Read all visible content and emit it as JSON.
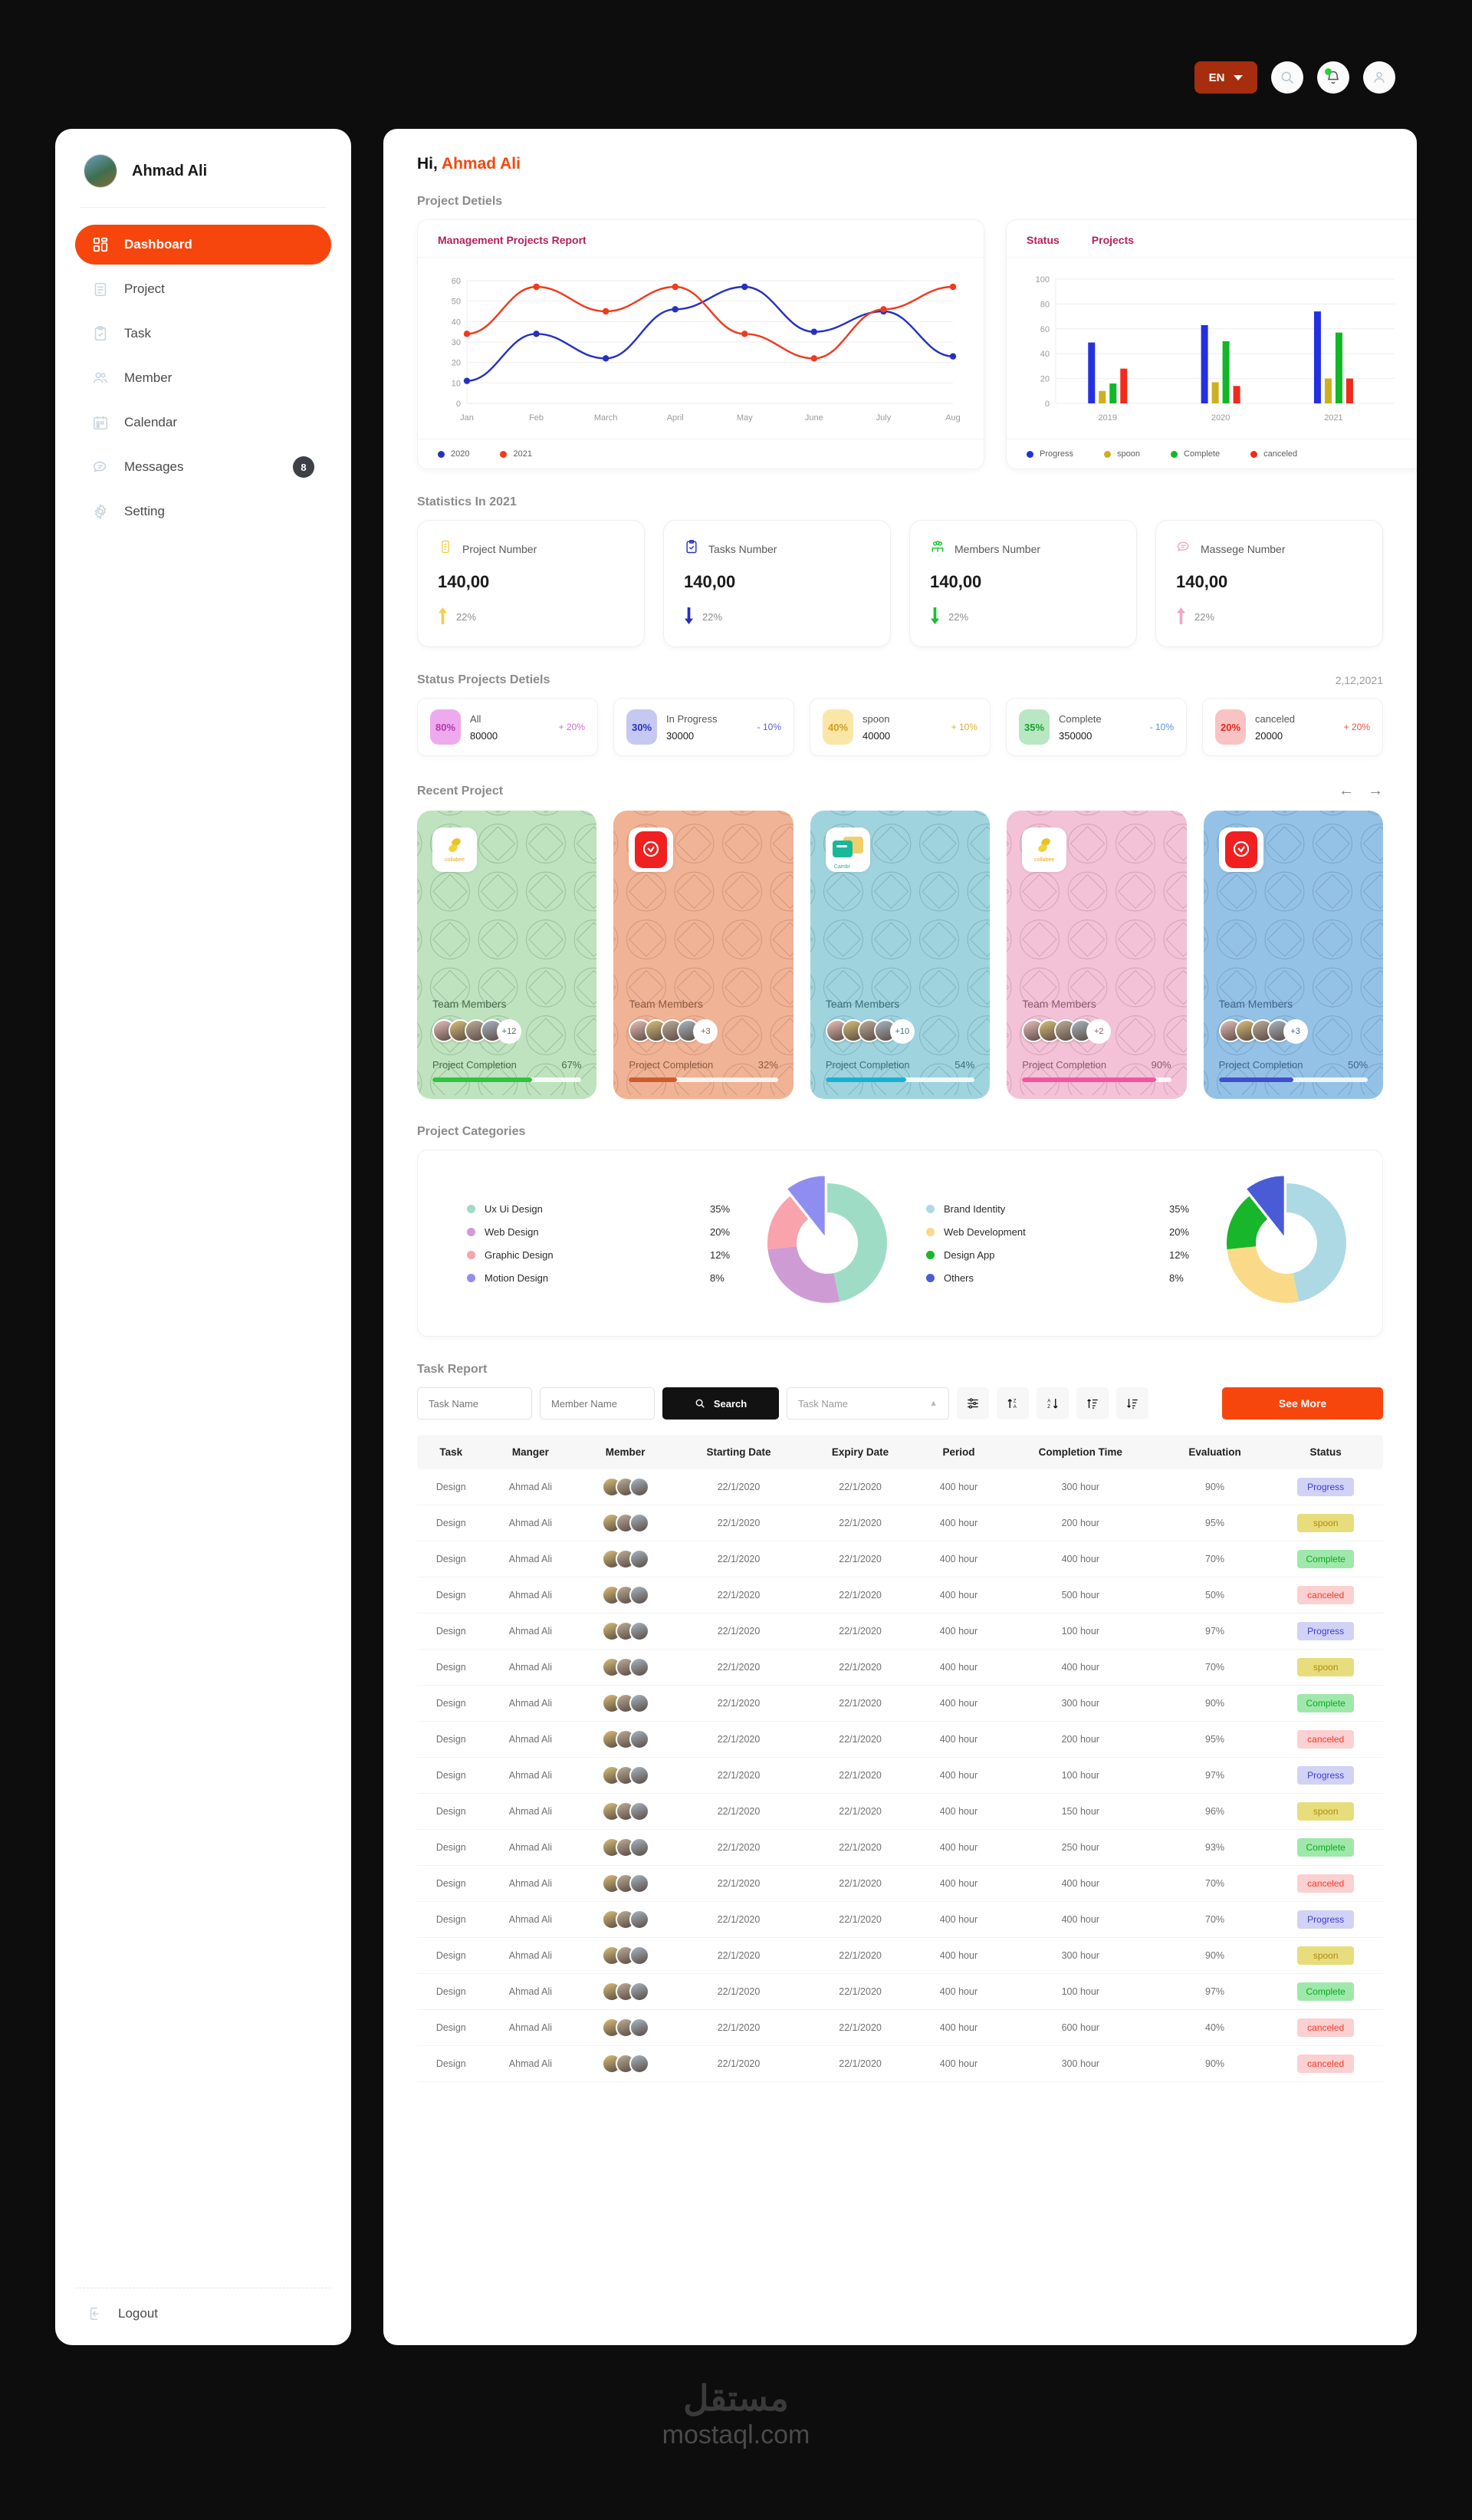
{
  "topbar": {
    "language": "EN",
    "icons": [
      "search-icon",
      "bell-icon",
      "user-icon"
    ]
  },
  "sidebar": {
    "user_name": "Ahmad Ali",
    "items": [
      {
        "label": "Dashboard",
        "icon": "grid-icon",
        "active": true,
        "badge": ""
      },
      {
        "label": "Project",
        "icon": "notepad-icon",
        "active": false,
        "badge": ""
      },
      {
        "label": "Task",
        "icon": "clipboard-check-icon",
        "active": false,
        "badge": ""
      },
      {
        "label": "Member",
        "icon": "users-icon",
        "active": false,
        "badge": ""
      },
      {
        "label": "Calendar",
        "icon": "calendar-icon",
        "active": false,
        "badge": ""
      },
      {
        "label": "Messages",
        "icon": "chat-icon",
        "active": false,
        "badge": "8"
      },
      {
        "label": "Setting",
        "icon": "gear-icon",
        "active": false,
        "badge": ""
      }
    ],
    "logout_label": "Logout"
  },
  "main": {
    "greeting_prefix": "Hi,",
    "greeting_name": "Ahmad Ali",
    "project_details_title": "Project Detiels",
    "statistics_title": "Statistics In 2021",
    "status_projects_title": "Status Projects Detiels",
    "status_projects_date": "2,12,2021",
    "recent_project_title": "Recent Project",
    "project_categories_title": "Project Categories",
    "task_report_title": "Task Report"
  },
  "chart_data": [
    {
      "type": "line",
      "title": "Management Projects Report",
      "categories": [
        "Jan",
        "Feb",
        "March",
        "April",
        "May",
        "June",
        "July",
        "Aug"
      ],
      "series": [
        {
          "name": "2020",
          "color": "#2430c4",
          "values": [
            11,
            34,
            22,
            46,
            57,
            35,
            45,
            23
          ]
        },
        {
          "name": "2021",
          "color": "#f1391b",
          "values": [
            34,
            57,
            45,
            57,
            34,
            22,
            46,
            57
          ]
        }
      ],
      "ylim": [
        0,
        60
      ],
      "yticks": [
        0,
        10,
        20,
        30,
        40,
        50,
        60
      ],
      "xlabel": "",
      "ylabel": "",
      "grid": true,
      "legend_position": "bottom"
    },
    {
      "type": "bar",
      "title": "Status",
      "subtitle": "Projects",
      "categories": [
        "2019",
        "2020",
        "2021"
      ],
      "series": [
        {
          "name": "Progress",
          "color": "#2430e0",
          "values": [
            49,
            63,
            74
          ]
        },
        {
          "name": "spoon",
          "color": "#cdb021",
          "values": [
            10,
            17,
            20
          ]
        },
        {
          "name": "Complete",
          "color": "#11b726",
          "values": [
            16,
            50,
            57
          ]
        },
        {
          "name": "canceled",
          "color": "#f12a1c",
          "values": [
            28,
            14,
            20
          ]
        }
      ],
      "ylim": [
        0,
        100
      ],
      "yticks": [
        0,
        20,
        40,
        60,
        80,
        100
      ],
      "xlabel": "",
      "ylabel": "",
      "grid": true,
      "legend_position": "bottom"
    },
    {
      "type": "pie",
      "title": "Project Categories (left)",
      "labels": [
        "Ux Ui Design",
        "Web Design",
        "Graphic Design",
        "Motion Design"
      ],
      "values": [
        35,
        20,
        12,
        8
      ],
      "colors": [
        "#9fdcc6",
        "#cf9bd4",
        "#f9a3ac",
        "#8f8df0"
      ],
      "legend_position": "left"
    },
    {
      "type": "pie",
      "title": "Project Categories (right)",
      "labels": [
        "Brand Identity",
        "Web Development",
        "Design App",
        "Others"
      ],
      "values": [
        35,
        20,
        12,
        8
      ],
      "colors": [
        "#add9e4",
        "#fada88",
        "#18b62a",
        "#4a5bd6"
      ],
      "legend_position": "left"
    }
  ],
  "statistics": [
    {
      "label": "Project Number",
      "value": "140,00",
      "delta": "22%",
      "direction": "up",
      "icon": "notepad-icon",
      "color": "#f2cf52"
    },
    {
      "label": "Tasks Number",
      "value": "140,00",
      "delta": "22%",
      "direction": "down",
      "icon": "clipboard-check-icon",
      "color": "#2430c4"
    },
    {
      "label": "Members Number",
      "value": "140,00",
      "delta": "22%",
      "direction": "down",
      "icon": "users-icon",
      "color": "#19c131"
    },
    {
      "label": "Massege Number",
      "value": "140,00",
      "delta": "22%",
      "direction": "up",
      "icon": "chat-icon",
      "color": "#eda9c4"
    }
  ],
  "status_projects": [
    {
      "percent": "80%",
      "name": "All",
      "count": "80000",
      "delta": "+ 20%",
      "badge_bg": "#edaaec",
      "badge_fg": "#b43bb0",
      "delta_color": "#d36ad0"
    },
    {
      "percent": "30%",
      "name": "In Progress",
      "count": "30000",
      "delta": "- 10%",
      "badge_bg": "#c5c9f2",
      "badge_fg": "#2430c4",
      "delta_color": "#5964d8"
    },
    {
      "percent": "40%",
      "name": "spoon",
      "count": "40000",
      "delta": "+ 10%",
      "badge_bg": "#fae6a6",
      "badge_fg": "#d4a017",
      "delta_color": "#e0ae2a"
    },
    {
      "percent": "35%",
      "name": "Complete",
      "count": "350000",
      "delta": "- 10%",
      "badge_bg": "#b9e6c3",
      "badge_fg": "#13a32b",
      "delta_color": "#5a8fd8"
    },
    {
      "percent": "20%",
      "name": "canceled",
      "count": "20000",
      "delta": "+ 20%",
      "badge_bg": "#f9c3c3",
      "badge_fg": "#e8261a",
      "delta_color": "#ef5043"
    }
  ],
  "recent_projects": [
    {
      "logo": "collabee-logo",
      "bg": "#bfe3bf",
      "text": "#47694a",
      "members_label": "Team Members",
      "extra": "+12",
      "completion_label": "Project Completion",
      "percent": "67%",
      "bar_value": 67,
      "bar_color": "#30c43f"
    },
    {
      "logo": "shield-check-logo",
      "bg": "#f0b395",
      "text": "#8a5a42",
      "members_label": "Team Members",
      "extra": "+3",
      "completion_label": "Project Completion",
      "percent": "32%",
      "bar_value": 32,
      "bar_color": "#cc5b30"
    },
    {
      "logo": "cambr-logo",
      "bg": "#9fd4de",
      "text": "#3a6d7a",
      "members_label": "Team Members",
      "extra": "+10",
      "completion_label": "Project Completion",
      "percent": "54%",
      "bar_value": 54,
      "bar_color": "#18b0d4"
    },
    {
      "logo": "collabee-logo",
      "bg": "#f3c2d6",
      "text": "#8a5a70",
      "members_label": "Team Members",
      "extra": "+2",
      "completion_label": "Project Completion",
      "percent": "90%",
      "bar_value": 90,
      "bar_color": "#f255a0"
    },
    {
      "logo": "shield-check-logo",
      "bg": "#93c2e6",
      "text": "#3f6487",
      "members_label": "Team Members",
      "extra": "+3",
      "completion_label": "Project Completion",
      "percent": "50%",
      "bar_value": 50,
      "bar_color": "#3f4fd0"
    }
  ],
  "toolbar": {
    "task_name_placeholder": "Task Name",
    "member_name_placeholder": "Member Name",
    "search_label": "Search",
    "select_value": "Task Name",
    "see_more_label": "See More",
    "sort_icons": [
      "filter-sliders-icon",
      "sort-za-icon",
      "sort-az-icon",
      "sort-asc-icon",
      "sort-desc-icon"
    ]
  },
  "table": {
    "columns": [
      "Task",
      "Manger",
      "Member",
      "Starting Date",
      "Expiry Date",
      "Period",
      "Completion Time",
      "Evaluation",
      "Status"
    ],
    "rows": [
      {
        "task": "Design",
        "manger": "Ahmad Ali",
        "start": "22/1/2020",
        "expiry": "22/1/2020",
        "period": "400 hour",
        "completion": "300 hour",
        "evaluation": "90%",
        "status": "Progress"
      },
      {
        "task": "Design",
        "manger": "Ahmad Ali",
        "start": "22/1/2020",
        "expiry": "22/1/2020",
        "period": "400 hour",
        "completion": "200 hour",
        "evaluation": "95%",
        "status": "spoon"
      },
      {
        "task": "Design",
        "manger": "Ahmad Ali",
        "start": "22/1/2020",
        "expiry": "22/1/2020",
        "period": "400 hour",
        "completion": "400 hour",
        "evaluation": "70%",
        "status": "Complete"
      },
      {
        "task": "Design",
        "manger": "Ahmad Ali",
        "start": "22/1/2020",
        "expiry": "22/1/2020",
        "period": "400 hour",
        "completion": "500 hour",
        "evaluation": "50%",
        "status": "canceled"
      },
      {
        "task": "Design",
        "manger": "Ahmad Ali",
        "start": "22/1/2020",
        "expiry": "22/1/2020",
        "period": "400 hour",
        "completion": "100 hour",
        "evaluation": "97%",
        "status": "Progress"
      },
      {
        "task": "Design",
        "manger": "Ahmad Ali",
        "start": "22/1/2020",
        "expiry": "22/1/2020",
        "period": "400 hour",
        "completion": "400 hour",
        "evaluation": "70%",
        "status": "spoon"
      },
      {
        "task": "Design",
        "manger": "Ahmad Ali",
        "start": "22/1/2020",
        "expiry": "22/1/2020",
        "period": "400 hour",
        "completion": "300 hour",
        "evaluation": "90%",
        "status": "Complete"
      },
      {
        "task": "Design",
        "manger": "Ahmad Ali",
        "start": "22/1/2020",
        "expiry": "22/1/2020",
        "period": "400 hour",
        "completion": "200 hour",
        "evaluation": "95%",
        "status": "canceled"
      },
      {
        "task": "Design",
        "manger": "Ahmad Ali",
        "start": "22/1/2020",
        "expiry": "22/1/2020",
        "period": "400 hour",
        "completion": "100 hour",
        "evaluation": "97%",
        "status": "Progress"
      },
      {
        "task": "Design",
        "manger": "Ahmad Ali",
        "start": "22/1/2020",
        "expiry": "22/1/2020",
        "period": "400 hour",
        "completion": "150 hour",
        "evaluation": "96%",
        "status": "spoon"
      },
      {
        "task": "Design",
        "manger": "Ahmad Ali",
        "start": "22/1/2020",
        "expiry": "22/1/2020",
        "period": "400 hour",
        "completion": "250 hour",
        "evaluation": "93%",
        "status": "Complete"
      },
      {
        "task": "Design",
        "manger": "Ahmad Ali",
        "start": "22/1/2020",
        "expiry": "22/1/2020",
        "period": "400 hour",
        "completion": "400 hour",
        "evaluation": "70%",
        "status": "canceled"
      },
      {
        "task": "Design",
        "manger": "Ahmad Ali",
        "start": "22/1/2020",
        "expiry": "22/1/2020",
        "period": "400 hour",
        "completion": "400 hour",
        "evaluation": "70%",
        "status": "Progress"
      },
      {
        "task": "Design",
        "manger": "Ahmad Ali",
        "start": "22/1/2020",
        "expiry": "22/1/2020",
        "period": "400 hour",
        "completion": "300 hour",
        "evaluation": "90%",
        "status": "spoon"
      },
      {
        "task": "Design",
        "manger": "Ahmad Ali",
        "start": "22/1/2020",
        "expiry": "22/1/2020",
        "period": "400 hour",
        "completion": "100 hour",
        "evaluation": "97%",
        "status": "Complete"
      },
      {
        "task": "Design",
        "manger": "Ahmad Ali",
        "start": "22/1/2020",
        "expiry": "22/1/2020",
        "period": "400 hour",
        "completion": "600 hour",
        "evaluation": "40%",
        "status": "canceled"
      },
      {
        "task": "Design",
        "manger": "Ahmad Ali",
        "start": "22/1/2020",
        "expiry": "22/1/2020",
        "period": "400 hour",
        "completion": "300 hour",
        "evaluation": "90%",
        "status": "canceled"
      }
    ],
    "status_styles": {
      "Progress": {
        "bg": "#d2d2f7",
        "fg": "#3b3bd0"
      },
      "spoon": {
        "bg": "#e8dd7c",
        "fg": "#b08a12"
      },
      "Complete": {
        "bg": "#9fe8ab",
        "fg": "#0ba81e"
      },
      "canceled": {
        "bg": "#fbd0d0",
        "fg": "#f2392b"
      }
    }
  },
  "footer": {
    "watermark_ar": "مستقل",
    "watermark_en": "mostaql.com"
  }
}
